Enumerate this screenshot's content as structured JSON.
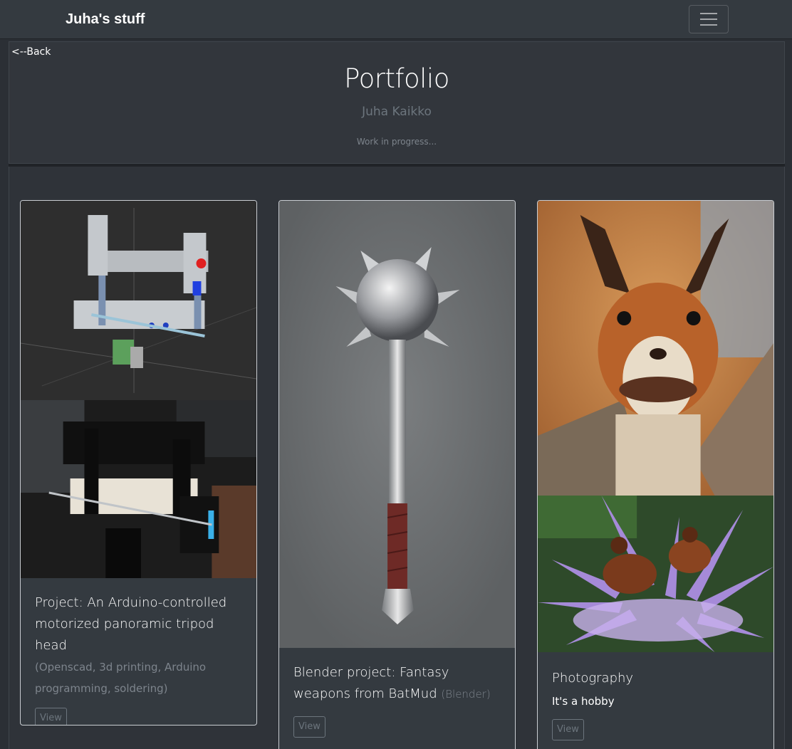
{
  "navbar": {
    "brand": "Juha's stuff",
    "toggle_icon": "hamburger-menu-icon"
  },
  "header": {
    "back_link": "<--Back",
    "title": "Portfolio",
    "subtitle": "Juha Kaikko",
    "note": "Work in progress..."
  },
  "cards": [
    {
      "title": "Project: An Arduino-controlled motorized panoramic tripod head",
      "tags": "(Openscad, 3d printing, Arduino programming, soldering)",
      "button": "View",
      "images": [
        "openscad-tripod-head-render",
        "tripod-head-photo"
      ]
    },
    {
      "title": "Blender project: Fantasy weapons from BatMud",
      "tags": "(Blender)",
      "button": "View",
      "images": [
        "spiked-mace-render"
      ]
    },
    {
      "title": "Photography",
      "subtitle": "It's a hobby",
      "button": "View",
      "images": [
        "squirrel-photo",
        "insects-on-flower-photo"
      ]
    }
  ],
  "colors": {
    "navbar_bg": "#343a40",
    "page_bg": "#2b2f35",
    "muted_text": "#6c757d",
    "card_border": "#c9cdd2"
  }
}
